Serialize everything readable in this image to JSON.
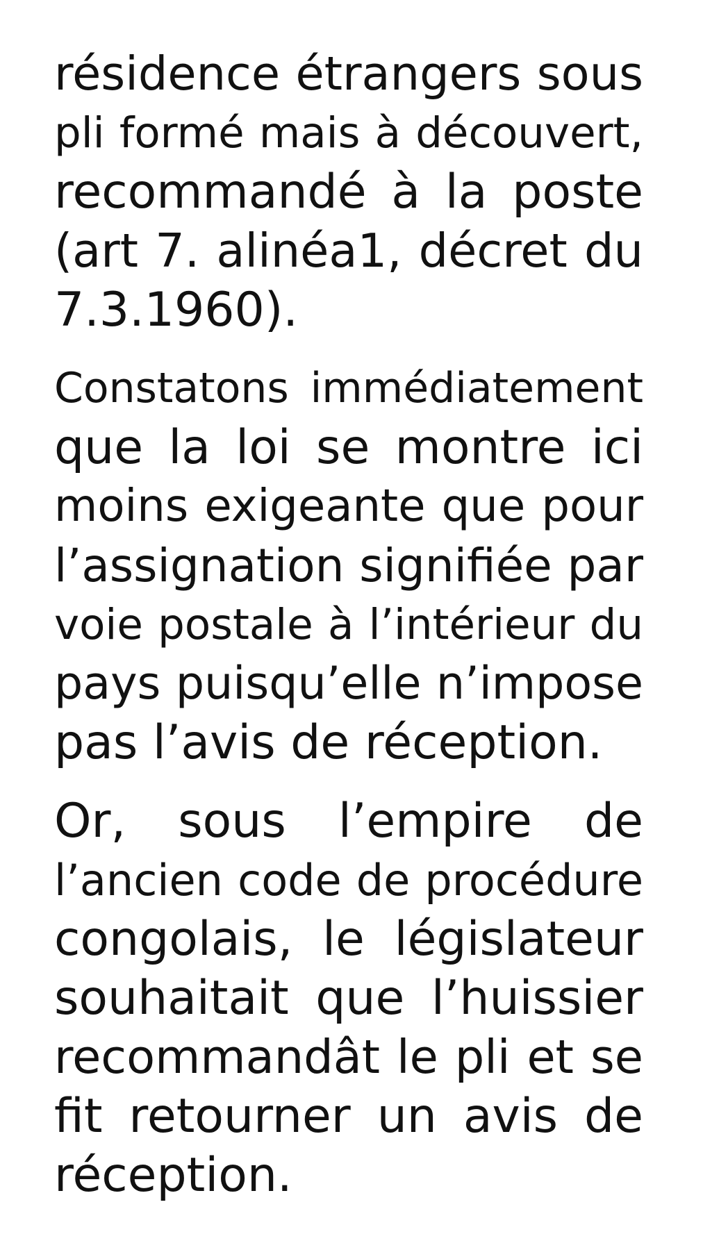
{
  "document": {
    "paragraphs": [
      {
        "lines": [
          "résidence étrangers sous",
          "pli formé mais à découvert,",
          "recommandé à la poste",
          "(art 7. alinéa1, décret du",
          "7.3.1960)."
        ]
      },
      {
        "lines": [
          "Constatons immédiatement",
          "que la loi se montre ici",
          "moins exigeante que pour",
          "l’assignation signifiée par",
          "voie postale à l’intérieur du",
          "pays puisqu’elle n’impose",
          "pas l’avis de réception."
        ]
      },
      {
        "lines": [
          "Or, sous l’empire de",
          "l’ancien code de procédure",
          "congolais, le législateur",
          "souhaitait que l’huissier",
          "recommandât le pli et se",
          "fit retourner un avis de",
          "réception."
        ]
      }
    ]
  }
}
